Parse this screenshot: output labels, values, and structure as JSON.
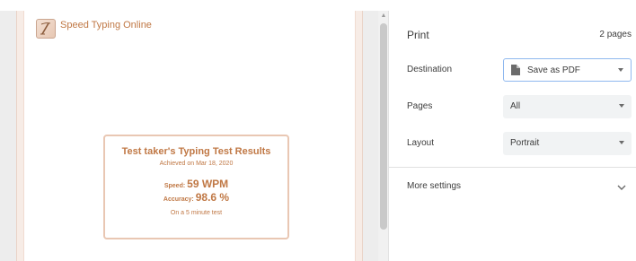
{
  "preview": {
    "site_title": "Speed Typing Online",
    "certificate": {
      "title": "Test taker's Typing Test Results",
      "achieved": "Achieved on Mar 18, 2020",
      "speed_label": "Speed:",
      "speed_value": "59 WPM",
      "accuracy_label": "Accuracy:",
      "accuracy_value": "98.6 %",
      "footer": "On a 5 minute test"
    }
  },
  "settings": {
    "title": "Print",
    "page_count": "2 pages",
    "destination": {
      "label": "Destination",
      "value": "Save as PDF",
      "icon": "document-icon"
    },
    "pages": {
      "label": "Pages",
      "value": "All"
    },
    "layout": {
      "label": "Layout",
      "value": "Portrait"
    },
    "more_settings": "More settings"
  },
  "colors": {
    "accent": "#c07845",
    "select_bg": "#f1f3f4",
    "focus_border": "#8fb8ef"
  }
}
